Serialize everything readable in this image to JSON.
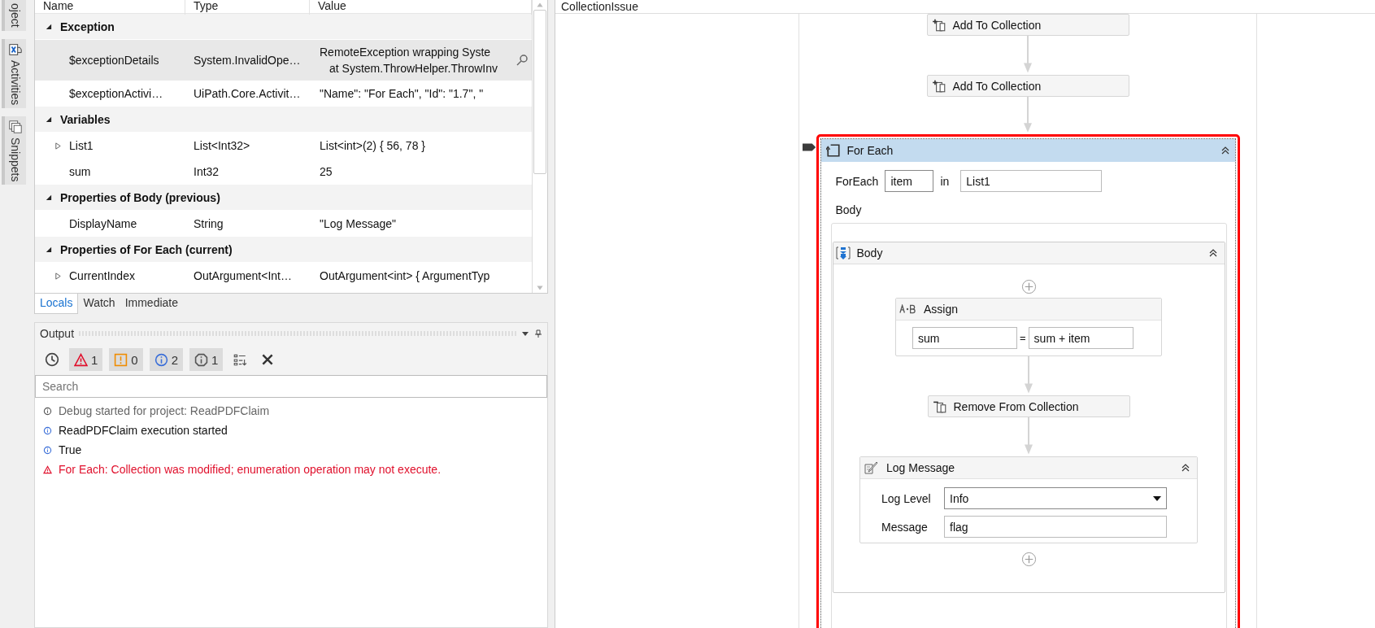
{
  "side_tabs": [
    {
      "label": "oject",
      "kind": "plain"
    },
    {
      "label": "Activities",
      "kind": "activities"
    },
    {
      "label": "Snippets",
      "kind": "snippets"
    }
  ],
  "locals": {
    "columns": [
      "Name",
      "Type",
      "Value"
    ],
    "groups": [
      {
        "title": "Exception",
        "expanded": true,
        "rows": [
          {
            "name": "$exceptionDetails",
            "type": "System.InvalidOpe…",
            "value": [
              "RemoteException wrapping Syste",
              "at System.ThrowHelper.ThrowInv"
            ],
            "selected": true,
            "kind": "visualizer"
          },
          {
            "name": "$exceptionActivi…",
            "type": "UiPath.Core.Activit…",
            "value": [
              "\"Name\": \"For Each\",  \"Id\": \"1.7\",  \""
            ],
            "selected": false,
            "kind": "plain"
          }
        ]
      },
      {
        "title": "Variables",
        "expanded": true,
        "rows": [
          {
            "name": "List1",
            "type": "List<Int32>",
            "value": [
              "List<int>(2) { 56, 78 }"
            ],
            "selected": false,
            "kind": "plain",
            "expanded": false
          },
          {
            "name": "sum",
            "type": "Int32",
            "value": [
              "25"
            ],
            "selected": false,
            "kind": "plain"
          }
        ]
      },
      {
        "title": "Properties of Body (previous)",
        "expanded": true,
        "rows": [
          {
            "name": "DisplayName",
            "type": "String",
            "value": [
              "\"Log Message\""
            ],
            "selected": false,
            "kind": "plain"
          }
        ]
      },
      {
        "title": "Properties of For Each (current)",
        "expanded": true,
        "rows": [
          {
            "name": "CurrentIndex",
            "type": "OutArgument<Int…",
            "value": [
              "OutArgument<int> { ArgumentTyp"
            ],
            "selected": false,
            "kind": "plain",
            "expanded": false
          }
        ]
      }
    ]
  },
  "debug_tabs": [
    {
      "label": "Locals",
      "selected": true
    },
    {
      "label": "Watch",
      "selected": false
    },
    {
      "label": "Immediate",
      "selected": false
    }
  ],
  "output": {
    "title": "Output",
    "filters": [
      {
        "kind": "timestamp",
        "selected": false
      },
      {
        "kind": "error",
        "count": "1",
        "selected": true
      },
      {
        "kind": "warning",
        "count": "0",
        "selected": true
      },
      {
        "kind": "info",
        "count": "2",
        "selected": true
      },
      {
        "kind": "trace",
        "count": "1",
        "selected": true
      },
      {
        "kind": "collapse"
      },
      {
        "kind": "clear"
      }
    ],
    "search": {
      "placeholder": "Search"
    },
    "messages": [
      {
        "kind": "trace",
        "text": "Debug started for project: ReadPDFClaim"
      },
      {
        "kind": "info",
        "text": "ReadPDFClaim execution started"
      },
      {
        "kind": "info",
        "text": "True"
      },
      {
        "kind": "error",
        "text": "For Each: Collection was modified; enumeration operation may not execute."
      }
    ]
  },
  "designer": {
    "title": "CollectionIssue",
    "activities": [
      {
        "kind": "add",
        "title": "Add To Collection"
      },
      {
        "kind": "add",
        "title": "Add To Collection"
      },
      {
        "kind": "foreach",
        "title": "For Each",
        "error": true,
        "current": true,
        "expanded": true,
        "label": "ForEach",
        "item": "item",
        "in_label": "in",
        "collection": "List1",
        "body_label": "Body",
        "body": {
          "title": "Body",
          "expanded": true,
          "activities": [
            {
              "kind": "assign",
              "title": "Assign",
              "to": "sum",
              "operator": "=",
              "value": "sum + item"
            },
            {
              "kind": "remove",
              "title": "Remove From Collection"
            },
            {
              "kind": "log",
              "title": "Log Message",
              "expanded": true,
              "level_label": "Log Level",
              "level": "Info",
              "message_label": "Message",
              "message": "flag"
            }
          ]
        }
      }
    ]
  }
}
